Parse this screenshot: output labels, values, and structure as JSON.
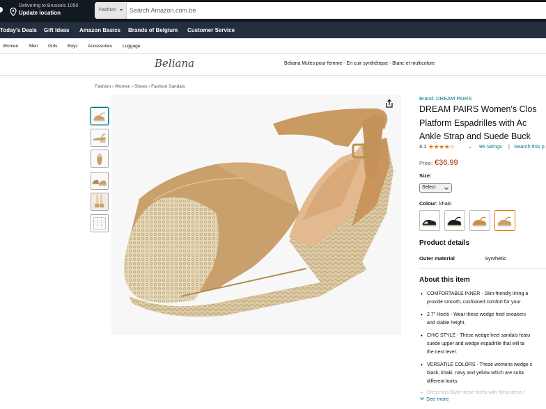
{
  "header": {
    "delivery_line1": "Delivering to Brussels 1050",
    "delivery_line2": "Update location",
    "search_category": "Fashion",
    "search_placeholder": "Search Amazon.com.be"
  },
  "subnav": {
    "items": [
      "Today's Deals",
      "Gift Ideas",
      "Amazon Basics",
      "Brands of Belgium",
      "Customer Service"
    ]
  },
  "category_nav": {
    "items": [
      "Women",
      "Men",
      "Girls",
      "Boys",
      "Accessories",
      "Luggage"
    ]
  },
  "brand_banner": {
    "logo": "Beliana",
    "tagline": "Beliana Mules pour femme - En cuir synthétique - Blanc et multicolore"
  },
  "breadcrumb": "Fashion › Women › Shoes › Fashion Sandals",
  "product": {
    "brand_link": "Brand: DREAM PAIRS",
    "title_lines": [
      "DREAM PAIRS Women's Clos",
      "Platform Espadrilles with Ac",
      "Ankle Strap and Suede Buck"
    ],
    "rating": "4.1",
    "stars": "★★★★☆",
    "ratings_count": "96 ratings",
    "separator": "|",
    "search_link": "Search this p",
    "price_label": "Price:",
    "price": "€36.99",
    "size_label": "Size:",
    "size_value": "Select",
    "colour_label": "Colour:",
    "colour_value": "khaki",
    "product_details_title": "Product details",
    "outer_material_label": "Outer material",
    "outer_material_value": "Synthetic",
    "about_title": "About this item",
    "bullets": [
      {
        "l1": "COMFORTABLE INNER - Skin-friendly lining a",
        "l2": "provide smooth, cushioned comfort for your"
      },
      {
        "l1": "2.7\" Heels - Wear these wedge heel sneakers",
        "l2": "and stable height."
      },
      {
        "l1": "CHIC STYLE - These wedge heel sandals featu",
        "l2": "suede upper and wedge espadrille that will ta",
        "l3": "the next level."
      },
      {
        "l1": "VERSATILE COLORS - These womens wedge s",
        "l2": "black, khaki, navy and yellow which are suita",
        "l3": "different looks."
      }
    ],
    "faded_bullet": "Dress tips:Style these heels with floral dress f",
    "see_more": "See more"
  },
  "colors": {
    "header_bg": "#131921",
    "subnav_bg": "#232f3e",
    "link": "#007185",
    "price": "#b12704",
    "stars": "#de7921",
    "selected_swatch": "#e77600",
    "khaki": "#c9a06b"
  }
}
